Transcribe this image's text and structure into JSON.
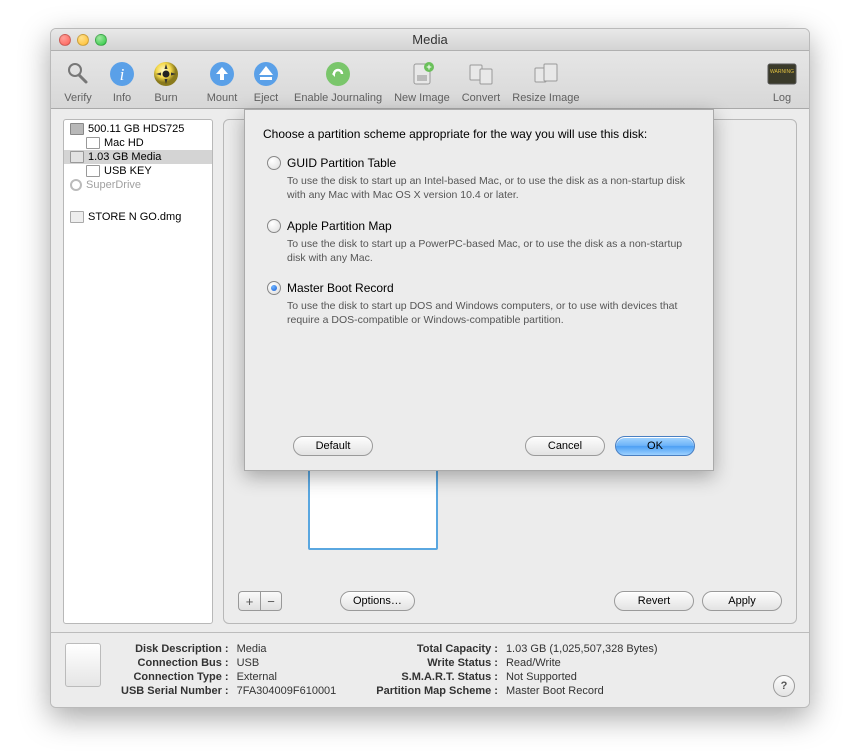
{
  "window": {
    "title": "Media"
  },
  "toolbar": {
    "verify": "Verify",
    "info": "Info",
    "burn": "Burn",
    "mount": "Mount",
    "eject": "Eject",
    "journal": "Enable Journaling",
    "newimage": "New Image",
    "convert": "Convert",
    "resize": "Resize Image",
    "log": "Log"
  },
  "sidebar": {
    "items": [
      {
        "label": "500.11 GB HDS725"
      },
      {
        "label": "Mac HD"
      },
      {
        "label": "1.03 GB Media"
      },
      {
        "label": "USB KEY"
      },
      {
        "label": "SuperDrive"
      },
      {
        "label": "STORE N GO.dmg"
      }
    ]
  },
  "partition": {
    "plus": "+",
    "minus": "−",
    "options": "Options…",
    "revert": "Revert",
    "apply": "Apply"
  },
  "sheet": {
    "prompt": "Choose a partition scheme appropriate for the way you will use this disk:",
    "options": [
      {
        "label": "GUID Partition Table",
        "desc": "To use the disk to start up an Intel-based Mac, or to use the disk as a non-startup disk with any Mac with Mac OS X version 10.4 or later."
      },
      {
        "label": "Apple Partition Map",
        "desc": "To use the disk to start up a PowerPC-based Mac, or to use the disk as a non-startup disk with any Mac."
      },
      {
        "label": "Master Boot Record",
        "desc": "To use the disk to start up DOS and Windows computers, or to use with devices that require a DOS-compatible or Windows-compatible partition."
      }
    ],
    "default": "Default",
    "cancel": "Cancel",
    "ok": "OK",
    "selected": 2
  },
  "info": {
    "left": [
      {
        "lbl": "Disk Description :",
        "val": "Media"
      },
      {
        "lbl": "Connection Bus :",
        "val": "USB"
      },
      {
        "lbl": "Connection Type :",
        "val": "External"
      },
      {
        "lbl": "USB Serial Number :",
        "val": "7FA304009F610001"
      }
    ],
    "right": [
      {
        "lbl": "Total Capacity :",
        "val": "1.03 GB (1,025,507,328 Bytes)"
      },
      {
        "lbl": "Write Status :",
        "val": "Read/Write"
      },
      {
        "lbl": "S.M.A.R.T. Status :",
        "val": "Not Supported"
      },
      {
        "lbl": "Partition Map Scheme :",
        "val": "Master Boot Record"
      }
    ]
  },
  "icons": {
    "help": "?"
  }
}
